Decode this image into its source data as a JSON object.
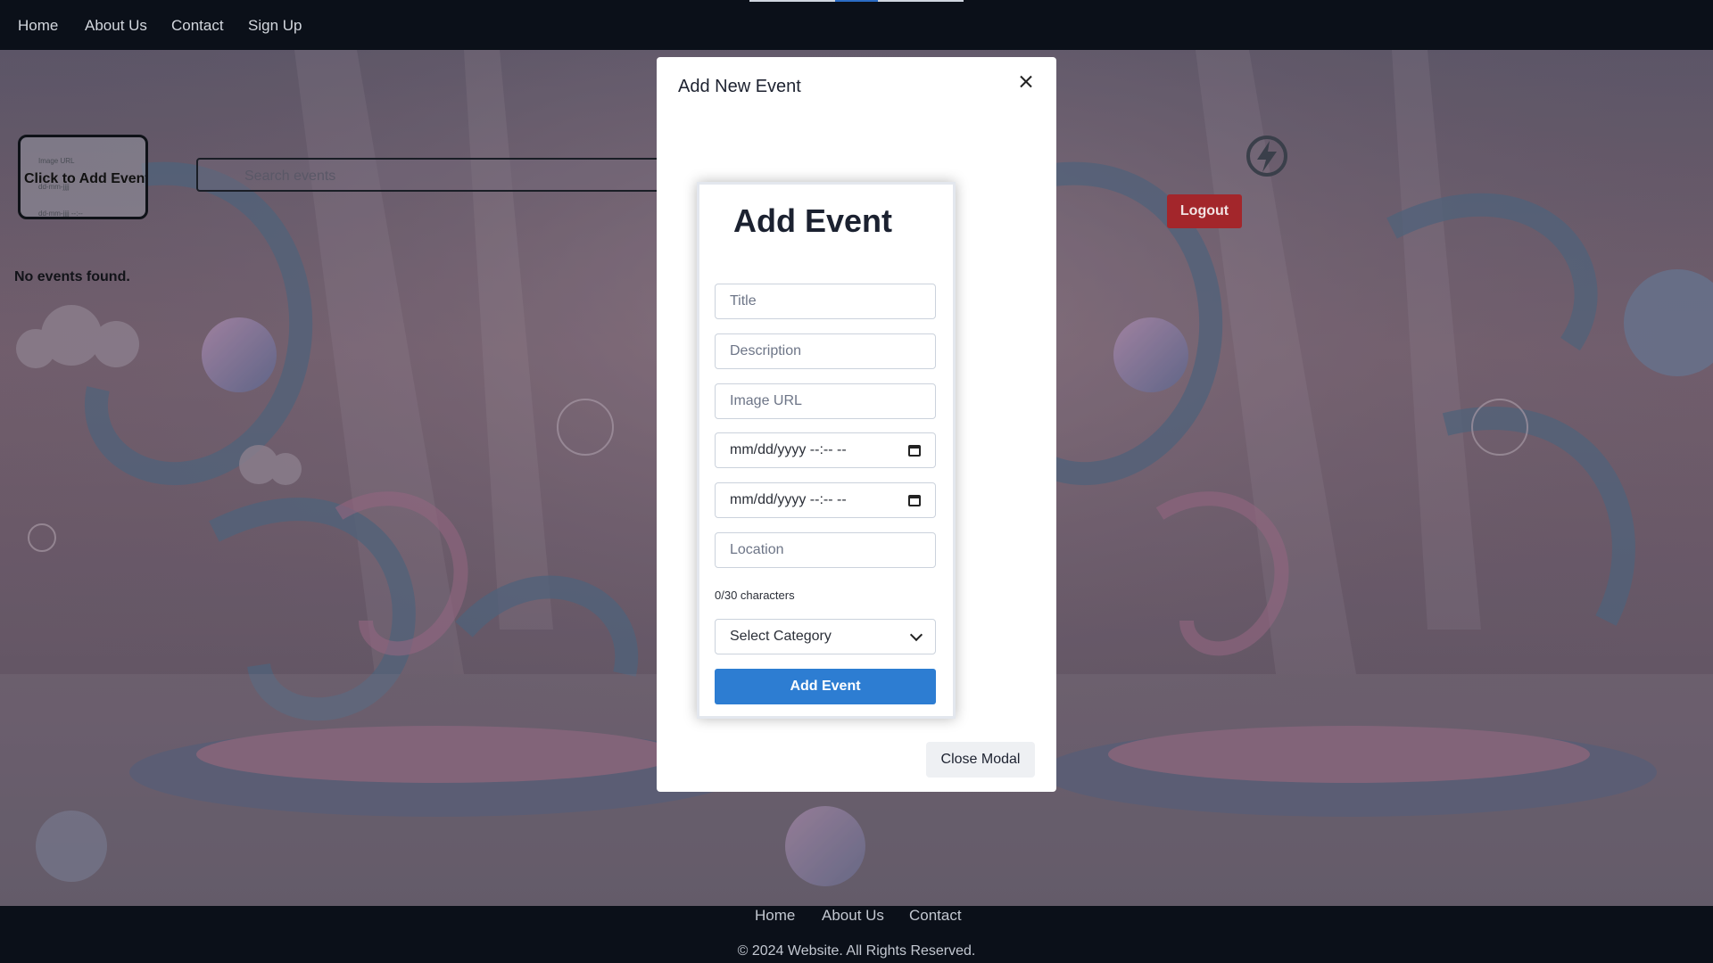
{
  "header": {
    "nav": [
      "Home",
      "About Us",
      "Contact",
      "Sign Up"
    ]
  },
  "page": {
    "add_tile": {
      "label": "Click to Add Event",
      "mini_url": "Image URL",
      "mini_date1": "dd-mm-jjjj",
      "mini_date2": "dd-mm-jjjj --:--"
    },
    "search": {
      "placeholder": "Search events"
    },
    "empty_text": "No events found.",
    "logout_label": "Logout"
  },
  "modal": {
    "title": "Add New Event",
    "close_label": "Close Modal",
    "form": {
      "heading": "Add Event",
      "title_placeholder": "Title",
      "description_placeholder": "Description",
      "image_url_placeholder": "Image URL",
      "start_datetime": "mm/dd/yyyy --:-- --",
      "end_datetime": "mm/dd/yyyy --:-- --",
      "location_placeholder": "Location",
      "char_counter": "0/30 characters",
      "category_selected": "Select Category",
      "submit_label": "Add Event"
    }
  },
  "footer": {
    "nav": [
      "Home",
      "About Us",
      "Contact"
    ],
    "copyright": "© 2024 Website. All Rights Reserved."
  },
  "colors": {
    "primary": "#2d7dd2",
    "danger": "#a3262b",
    "nav_bg": "#0b1019"
  },
  "icons": [
    "close-icon",
    "calendar-icon",
    "chevron-down-icon",
    "lightning-icon"
  ]
}
